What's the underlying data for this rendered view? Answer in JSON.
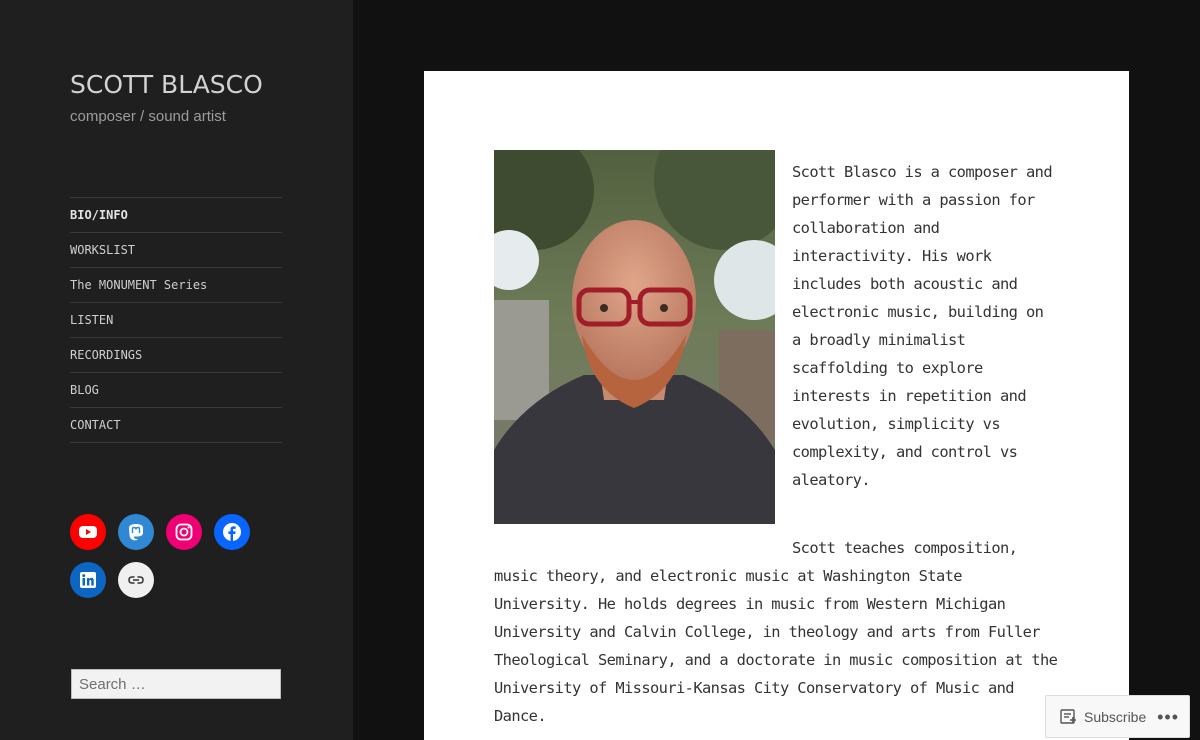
{
  "site": {
    "title": "SCOTT BLASCO",
    "description": "composer / sound artist"
  },
  "nav": [
    {
      "label": "BIO/INFO",
      "active": true
    },
    {
      "label": "WORKSLIST"
    },
    {
      "label": "The MONUMENT Series"
    },
    {
      "label": "LISTEN"
    },
    {
      "label": "RECORDINGS"
    },
    {
      "label": "BLOG"
    },
    {
      "label": "CONTACT"
    }
  ],
  "social": [
    {
      "name": "youtube-icon",
      "color": "#ff0000"
    },
    {
      "name": "mastodon-icon",
      "color": "#3088d4"
    },
    {
      "name": "instagram-icon",
      "color": "#f00075"
    },
    {
      "name": "facebook-icon",
      "color": "#0866ff"
    },
    {
      "name": "linkedin-icon",
      "color": "#0d66c2"
    },
    {
      "name": "link-icon",
      "color": "#f0f0f0"
    }
  ],
  "search": {
    "placeholder": "Search …"
  },
  "article": {
    "paragraph1": "Scott Blasco is a composer and performer with a passion for collaboration and interactivity. His work includes both acoustic and electronic music, building on a broadly minimalist scaffolding to explore interests in repetition and evolution, simplicity vs complexity, and control vs aleatory.",
    "paragraph2": "Scott teaches composition, music theory, and electronic music at Washington State University. He holds degrees in music from Western Michigan University and Calvin College, in theology and arts from Fuller Theological Seminary, and a doctorate in music composition at the University of Missouri-Kansas City Conservatory of Music and Dance."
  },
  "subscribe": {
    "label": "Subscribe",
    "more": "•••"
  }
}
